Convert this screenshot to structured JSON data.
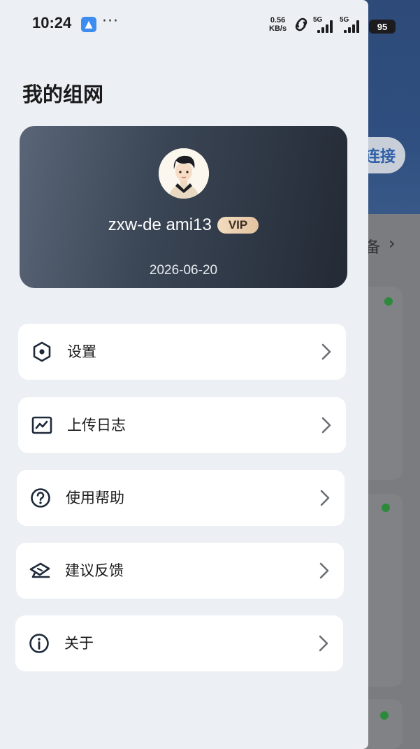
{
  "status_bar": {
    "time": "10:24",
    "more": "···",
    "net_speed_value": "0.56",
    "net_speed_unit": "KB/s",
    "signal_1_label": "5G",
    "signal_2_label": "5G",
    "battery": "95"
  },
  "page": {
    "title": "我的组网"
  },
  "profile": {
    "username": "zxw-de    ami13",
    "badge": "VIP",
    "expire_date": "2026-06-20"
  },
  "menu": [
    {
      "label": "设置",
      "icon": "settings-hexagon-icon"
    },
    {
      "label": "上传日志",
      "icon": "chart-upload-icon"
    },
    {
      "label": "使用帮助",
      "icon": "help-question-icon"
    },
    {
      "label": "建议反馈",
      "icon": "feedback-envelope-icon"
    },
    {
      "label": "关于",
      "icon": "info-icon"
    }
  ],
  "background": {
    "connect_button": "连接",
    "devices_title": "备"
  }
}
